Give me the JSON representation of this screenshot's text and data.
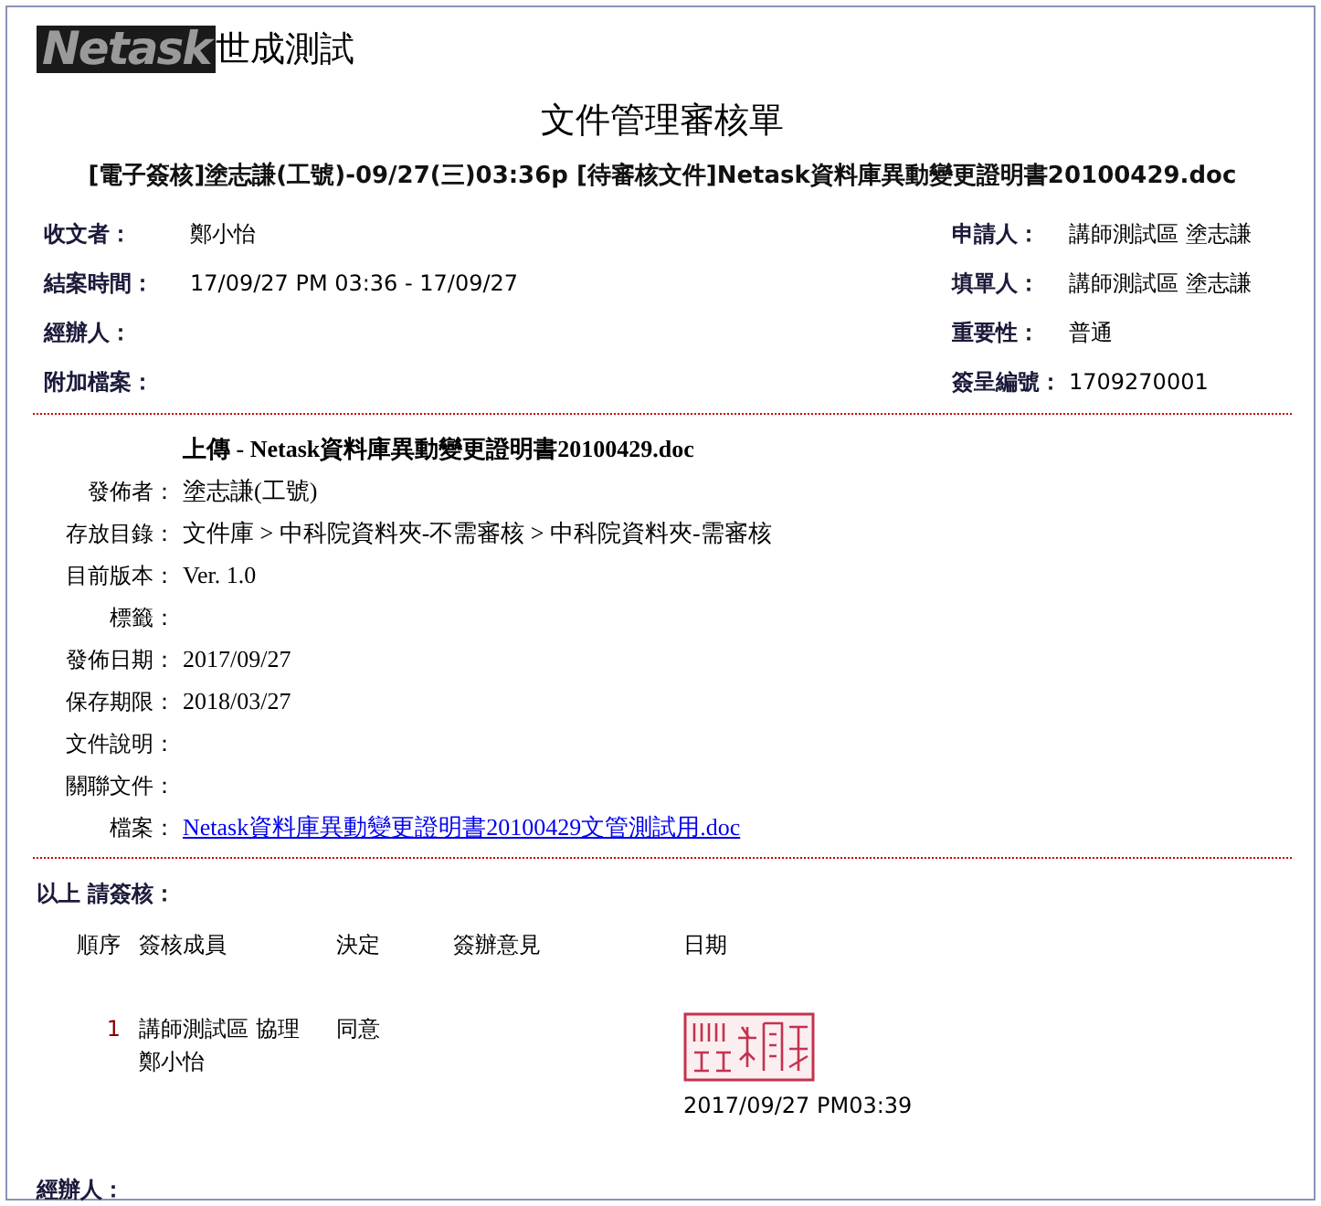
{
  "header": {
    "logo": "Netask",
    "company": "世成測試"
  },
  "title": "文件管理審核單",
  "subject": "[電子簽核]塗志謙(工號)-09/27(三)03:36p [待審核文件]Netask資料庫異動變更證明書20100429.doc",
  "info_left": [
    {
      "label": "收文者：",
      "value": "鄭小怡"
    },
    {
      "label": "結案時間：",
      "value": "17/09/27 PM 03:36 - 17/09/27"
    },
    {
      "label": "經辦人："
    },
    {
      "label": "附加檔案："
    }
  ],
  "info_right": [
    {
      "label": "申請人：",
      "value": "講師測試區 塗志謙"
    },
    {
      "label": "填單人：",
      "value": "講師測試區 塗志謙"
    },
    {
      "label": "重要性：",
      "value": "普通"
    },
    {
      "label": "簽呈編號：",
      "value": "1709270001"
    }
  ],
  "document": {
    "heading": "上傳 - Netask資料庫異動變更證明書20100429.doc",
    "fields": [
      {
        "label": "發佈者：",
        "value": "塗志謙(工號)",
        "kind": "text"
      },
      {
        "label": "存放目錄：",
        "value": "文件庫 > 中科院資料夾-不需審核 > 中科院資料夾-需審核",
        "kind": "text"
      },
      {
        "label": "目前版本：",
        "value": "Ver. 1.0",
        "kind": "text"
      },
      {
        "label": "標籤："
      },
      {
        "label": "發佈日期：",
        "value": "2017/09/27",
        "kind": "text"
      },
      {
        "label": "保存期限：",
        "value": "2018/03/27",
        "kind": "text"
      },
      {
        "label": "文件說明："
      },
      {
        "label": "關聯文件："
      },
      {
        "label": "檔案：",
        "value": "Netask資料庫異動變更證明書20100429文管測試用.doc",
        "kind": "link"
      }
    ]
  },
  "signoff": {
    "heading": "以上 請簽核：",
    "columns": [
      "順序",
      "簽核成員",
      "決定",
      "簽辦意見",
      "日期"
    ],
    "rows": [
      {
        "order": "1",
        "member_lines": [
          "講師測試區 協理",
          "鄭小怡"
        ],
        "decision": "同意",
        "stamped": true,
        "date": "2017/09/27 PM03:39"
      }
    ]
  },
  "footer": {
    "label": "經辦人："
  }
}
